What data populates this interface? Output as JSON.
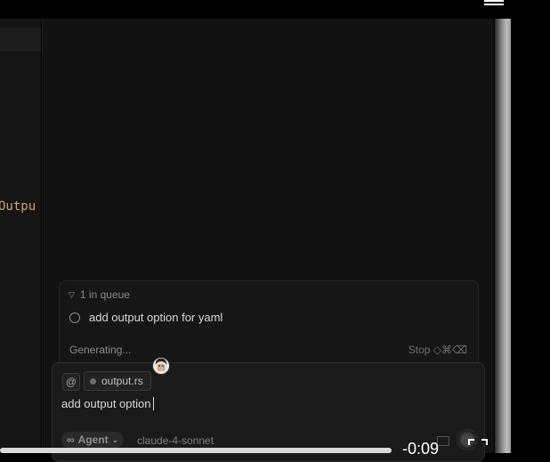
{
  "editor": {
    "code_fragment": "Outpu"
  },
  "queue": {
    "header": "1 in queue",
    "items": [
      {
        "label": "add output option for yaml"
      }
    ],
    "status": "Generating...",
    "stop_label": "Stop ◇⌘⌫"
  },
  "composer": {
    "at_symbol": "@",
    "context_file": "output.rs",
    "input_value": "add output option",
    "mode": "Agent",
    "mode_symbol": "∞",
    "model": "claude-4-sonnet"
  },
  "video": {
    "timecode": "-0:09"
  },
  "colors": {
    "code_keyword": "#d2a06a",
    "panel_bg": "#121212",
    "composer_bg": "#1a1a1a"
  }
}
